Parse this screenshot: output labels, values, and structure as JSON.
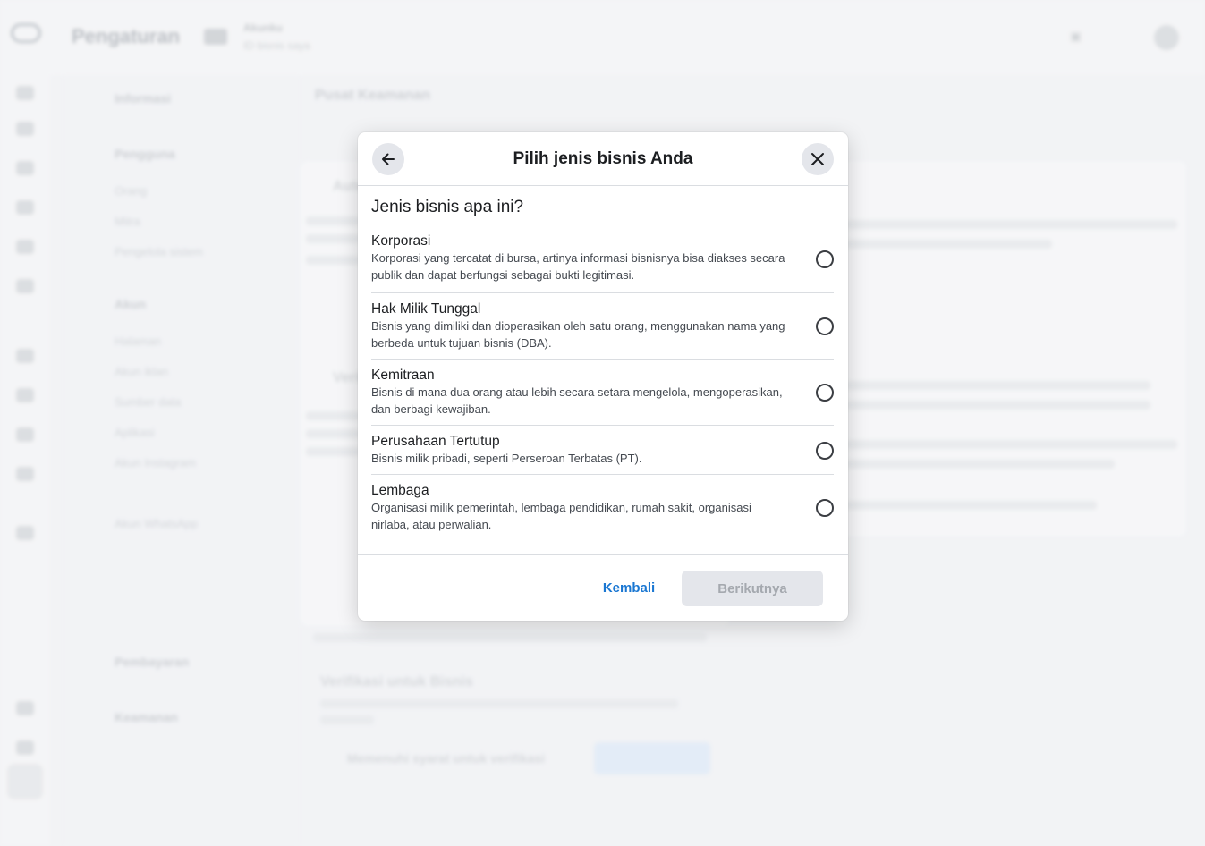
{
  "background": {
    "app_title": "Pengaturan",
    "account_name": "Akunku",
    "account_sub": "ID bisnis saya",
    "main_title": "Pusat Keamanan",
    "sidebar_items": [
      "Informasi",
      "Pengguna",
      "Orang",
      "Mitra",
      "Pengelola sistem",
      "Akun",
      "Halaman",
      "Akun iklan",
      "Sumber data",
      "Aplikasi",
      "Akun Instagram",
      "Akun WhatsApp",
      "Pembayaran",
      "Keamanan"
    ],
    "card_titles": [
      "Autentikasi",
      "Verifikasi",
      "Verifikasi untuk Bisnis"
    ],
    "verify_label": "Memenuhi syarat untuk verifikasi"
  },
  "modal": {
    "title": "Pilih jenis bisnis Anda",
    "question": "Jenis bisnis apa ini?",
    "options": [
      {
        "title": "Korporasi",
        "desc": "Korporasi yang tercatat di bursa, artinya informasi bisnisnya bisa diakses secara publik dan dapat berfungsi sebagai bukti legitimasi."
      },
      {
        "title": "Hak Milik Tunggal",
        "desc": "Bisnis yang dimiliki dan dioperasikan oleh satu orang, menggunakan nama yang berbeda untuk tujuan bisnis (DBA)."
      },
      {
        "title": "Kemitraan",
        "desc": "Bisnis di mana dua orang atau lebih secara setara mengelola, mengoperasikan, dan berbagi kewajiban."
      },
      {
        "title": "Perusahaan Tertutup",
        "desc": "Bisnis milik pribadi, seperti Perseroan Terbatas (PT)."
      },
      {
        "title": "Lembaga",
        "desc": "Organisasi milik pemerintah, lembaga pendidikan, rumah sakit, organisasi nirlaba, atau perwalian."
      }
    ],
    "back_label": "Kembali",
    "next_label": "Berikutnya"
  },
  "colors": {
    "accent": "#1a77d2",
    "disabled_bg": "#e4e6eb",
    "disabled_text": "#a5a9af"
  },
  "icons": {
    "back": "arrow-left-icon",
    "close": "close-icon"
  }
}
